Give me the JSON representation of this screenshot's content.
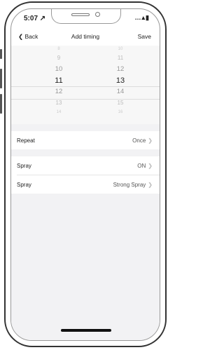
{
  "status": {
    "time": "5:07",
    "location_arrow": "↗",
    "icons": "…▴▮"
  },
  "nav": {
    "back_label": "Back",
    "title": "Add timing",
    "save_label": "Save"
  },
  "picker": {
    "hours": [
      "8",
      "9",
      "10",
      "11",
      "12",
      "13",
      "14"
    ],
    "minutes": [
      "10",
      "11",
      "12",
      "13",
      "14",
      "15",
      "16"
    ],
    "selected_hour": "11",
    "selected_minute": "13"
  },
  "settings": [
    {
      "label": "Repeat",
      "value": "Once"
    },
    {
      "label": "Spray",
      "value": "ON"
    },
    {
      "label": "Spray",
      "value": "Strong Spray"
    }
  ],
  "colors": {
    "background": "#f2f2f4",
    "panel": "#ffffff",
    "text": "#222222"
  }
}
